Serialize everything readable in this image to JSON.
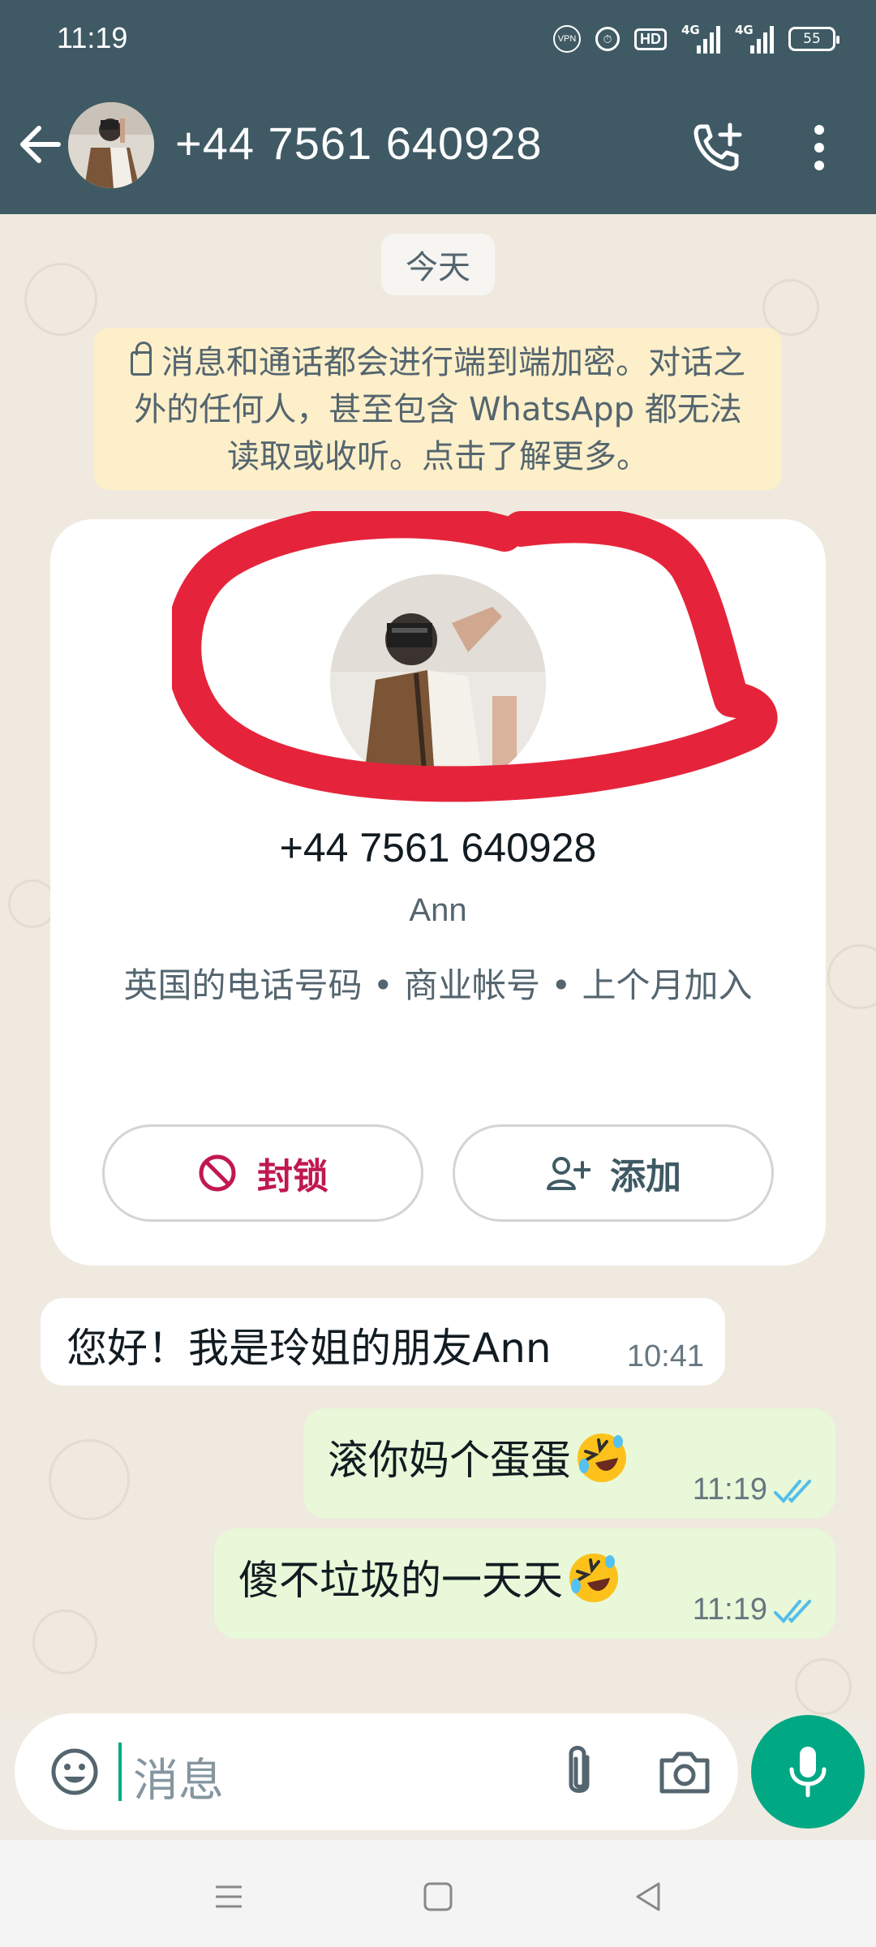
{
  "status_bar": {
    "time": "11:19",
    "vpn": "VPN",
    "hd": "HD",
    "signal1": "4G",
    "signal2": "4G",
    "battery": "55"
  },
  "header": {
    "title": "+44 7561 640928"
  },
  "chat": {
    "date_label": "今天",
    "encryption_notice": "消息和通话都会进行端到端加密。对话之外的任何人，甚至包含 WhatsApp 都无法读取或收听。点击了解更多。",
    "profile": {
      "phone": "+44 7561 640928",
      "name": "Ann",
      "info": "英国的电话号码 • 商业帐号 • 上个月加入",
      "block_label": "封锁",
      "add_label": "添加"
    },
    "messages": [
      {
        "direction": "incoming",
        "text": "您好！我是玲姐的朋友Ann",
        "time": "10:41"
      },
      {
        "direction": "outgoing",
        "text": "滚你妈个蛋蛋",
        "emoji": "rolling-on-floor-laughing",
        "time": "11:19",
        "status": "read"
      },
      {
        "direction": "outgoing",
        "text": "傻不垃圾的一天天",
        "emoji": "rolling-on-floor-laughing",
        "time": "11:19",
        "status": "read"
      }
    ]
  },
  "composer": {
    "placeholder": "消息"
  },
  "colors": {
    "header": "#3f5a64",
    "accent": "#00a884",
    "outgoing_bubble": "#e8f8d8",
    "block_red": "#c0184f",
    "annotation_red": "#e5243b",
    "read_ticks": "#53bdeb"
  }
}
